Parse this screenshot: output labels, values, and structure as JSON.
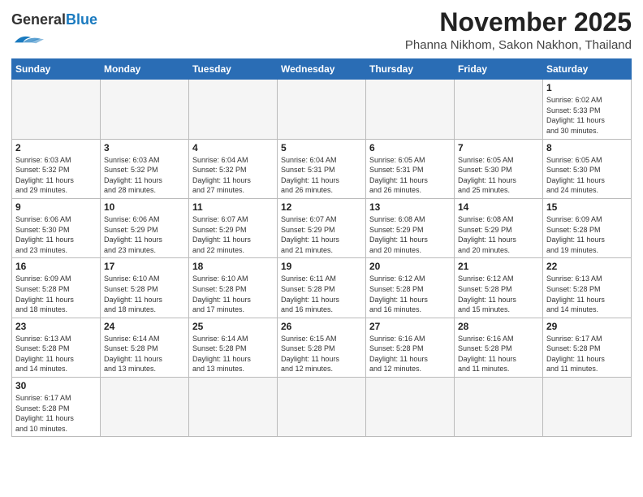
{
  "logo": {
    "general": "General",
    "blue": "Blue"
  },
  "header": {
    "month": "November 2025",
    "location": "Phanna Nikhom, Sakon Nakhon, Thailand"
  },
  "weekdays": [
    "Sunday",
    "Monday",
    "Tuesday",
    "Wednesday",
    "Thursday",
    "Friday",
    "Saturday"
  ],
  "weeks": [
    [
      {
        "day": "",
        "info": ""
      },
      {
        "day": "",
        "info": ""
      },
      {
        "day": "",
        "info": ""
      },
      {
        "day": "",
        "info": ""
      },
      {
        "day": "",
        "info": ""
      },
      {
        "day": "",
        "info": ""
      },
      {
        "day": "1",
        "info": "Sunrise: 6:02 AM\nSunset: 5:33 PM\nDaylight: 11 hours\nand 30 minutes."
      }
    ],
    [
      {
        "day": "2",
        "info": "Sunrise: 6:03 AM\nSunset: 5:32 PM\nDaylight: 11 hours\nand 29 minutes."
      },
      {
        "day": "3",
        "info": "Sunrise: 6:03 AM\nSunset: 5:32 PM\nDaylight: 11 hours\nand 28 minutes."
      },
      {
        "day": "4",
        "info": "Sunrise: 6:04 AM\nSunset: 5:32 PM\nDaylight: 11 hours\nand 27 minutes."
      },
      {
        "day": "5",
        "info": "Sunrise: 6:04 AM\nSunset: 5:31 PM\nDaylight: 11 hours\nand 26 minutes."
      },
      {
        "day": "6",
        "info": "Sunrise: 6:05 AM\nSunset: 5:31 PM\nDaylight: 11 hours\nand 26 minutes."
      },
      {
        "day": "7",
        "info": "Sunrise: 6:05 AM\nSunset: 5:30 PM\nDaylight: 11 hours\nand 25 minutes."
      },
      {
        "day": "8",
        "info": "Sunrise: 6:05 AM\nSunset: 5:30 PM\nDaylight: 11 hours\nand 24 minutes."
      }
    ],
    [
      {
        "day": "9",
        "info": "Sunrise: 6:06 AM\nSunset: 5:30 PM\nDaylight: 11 hours\nand 23 minutes."
      },
      {
        "day": "10",
        "info": "Sunrise: 6:06 AM\nSunset: 5:29 PM\nDaylight: 11 hours\nand 23 minutes."
      },
      {
        "day": "11",
        "info": "Sunrise: 6:07 AM\nSunset: 5:29 PM\nDaylight: 11 hours\nand 22 minutes."
      },
      {
        "day": "12",
        "info": "Sunrise: 6:07 AM\nSunset: 5:29 PM\nDaylight: 11 hours\nand 21 minutes."
      },
      {
        "day": "13",
        "info": "Sunrise: 6:08 AM\nSunset: 5:29 PM\nDaylight: 11 hours\nand 20 minutes."
      },
      {
        "day": "14",
        "info": "Sunrise: 6:08 AM\nSunset: 5:29 PM\nDaylight: 11 hours\nand 20 minutes."
      },
      {
        "day": "15",
        "info": "Sunrise: 6:09 AM\nSunset: 5:28 PM\nDaylight: 11 hours\nand 19 minutes."
      }
    ],
    [
      {
        "day": "16",
        "info": "Sunrise: 6:09 AM\nSunset: 5:28 PM\nDaylight: 11 hours\nand 18 minutes."
      },
      {
        "day": "17",
        "info": "Sunrise: 6:10 AM\nSunset: 5:28 PM\nDaylight: 11 hours\nand 18 minutes."
      },
      {
        "day": "18",
        "info": "Sunrise: 6:10 AM\nSunset: 5:28 PM\nDaylight: 11 hours\nand 17 minutes."
      },
      {
        "day": "19",
        "info": "Sunrise: 6:11 AM\nSunset: 5:28 PM\nDaylight: 11 hours\nand 16 minutes."
      },
      {
        "day": "20",
        "info": "Sunrise: 6:12 AM\nSunset: 5:28 PM\nDaylight: 11 hours\nand 16 minutes."
      },
      {
        "day": "21",
        "info": "Sunrise: 6:12 AM\nSunset: 5:28 PM\nDaylight: 11 hours\nand 15 minutes."
      },
      {
        "day": "22",
        "info": "Sunrise: 6:13 AM\nSunset: 5:28 PM\nDaylight: 11 hours\nand 14 minutes."
      }
    ],
    [
      {
        "day": "23",
        "info": "Sunrise: 6:13 AM\nSunset: 5:28 PM\nDaylight: 11 hours\nand 14 minutes."
      },
      {
        "day": "24",
        "info": "Sunrise: 6:14 AM\nSunset: 5:28 PM\nDaylight: 11 hours\nand 13 minutes."
      },
      {
        "day": "25",
        "info": "Sunrise: 6:14 AM\nSunset: 5:28 PM\nDaylight: 11 hours\nand 13 minutes."
      },
      {
        "day": "26",
        "info": "Sunrise: 6:15 AM\nSunset: 5:28 PM\nDaylight: 11 hours\nand 12 minutes."
      },
      {
        "day": "27",
        "info": "Sunrise: 6:16 AM\nSunset: 5:28 PM\nDaylight: 11 hours\nand 12 minutes."
      },
      {
        "day": "28",
        "info": "Sunrise: 6:16 AM\nSunset: 5:28 PM\nDaylight: 11 hours\nand 11 minutes."
      },
      {
        "day": "29",
        "info": "Sunrise: 6:17 AM\nSunset: 5:28 PM\nDaylight: 11 hours\nand 11 minutes."
      }
    ],
    [
      {
        "day": "30",
        "info": "Sunrise: 6:17 AM\nSunset: 5:28 PM\nDaylight: 11 hours\nand 10 minutes."
      },
      {
        "day": "",
        "info": ""
      },
      {
        "day": "",
        "info": ""
      },
      {
        "day": "",
        "info": ""
      },
      {
        "day": "",
        "info": ""
      },
      {
        "day": "",
        "info": ""
      },
      {
        "day": "",
        "info": ""
      }
    ]
  ]
}
